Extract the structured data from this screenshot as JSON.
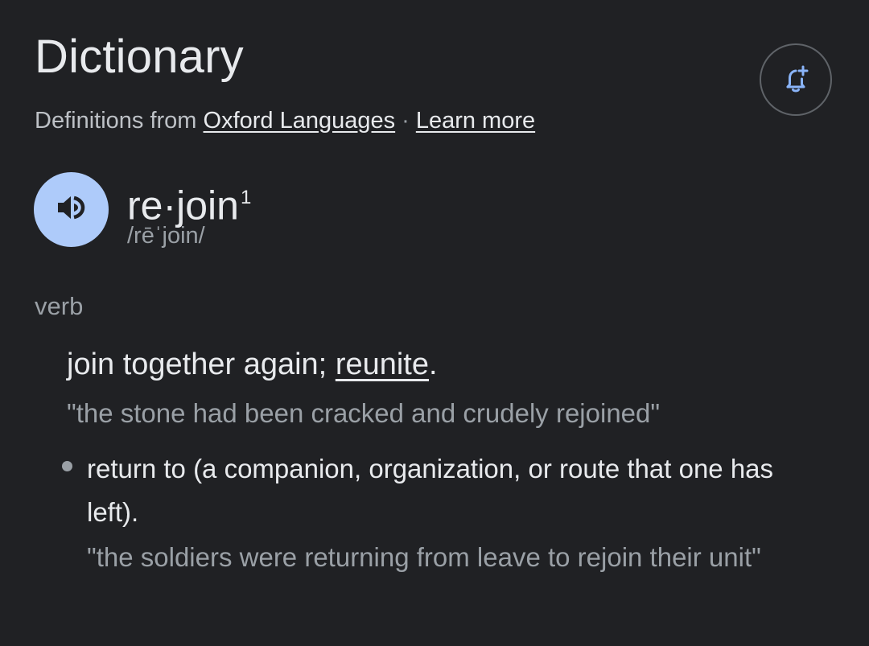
{
  "header": {
    "title": "Dictionary",
    "alert_icon": "bell-plus-icon"
  },
  "source": {
    "prefix": "Definitions from",
    "provider_link": "Oxford Languages",
    "separator": "·",
    "learn_more_link": "Learn more"
  },
  "entry": {
    "audio_icon": "speaker-icon",
    "word": "re·join",
    "homograph_number": "1",
    "phonetic": "/rēˈjoin/",
    "part_of_speech": "verb",
    "senses": [
      {
        "definition_prefix": "join together again; ",
        "definition_link": "reunite",
        "definition_suffix": ".",
        "example": "\"the stone had been cracked and crudely rejoined\""
      }
    ],
    "subsenses": [
      {
        "definition": "return to (a companion, organization, or route that one has left).",
        "example": "\"the soldiers were returning from leave to rejoin their unit\""
      }
    ]
  },
  "colors": {
    "background": "#202124",
    "primary_text": "#e8eaed",
    "secondary_text": "#9aa0a6",
    "accent_blue": "#aecbfa",
    "icon_blue": "#8ab4f8"
  }
}
